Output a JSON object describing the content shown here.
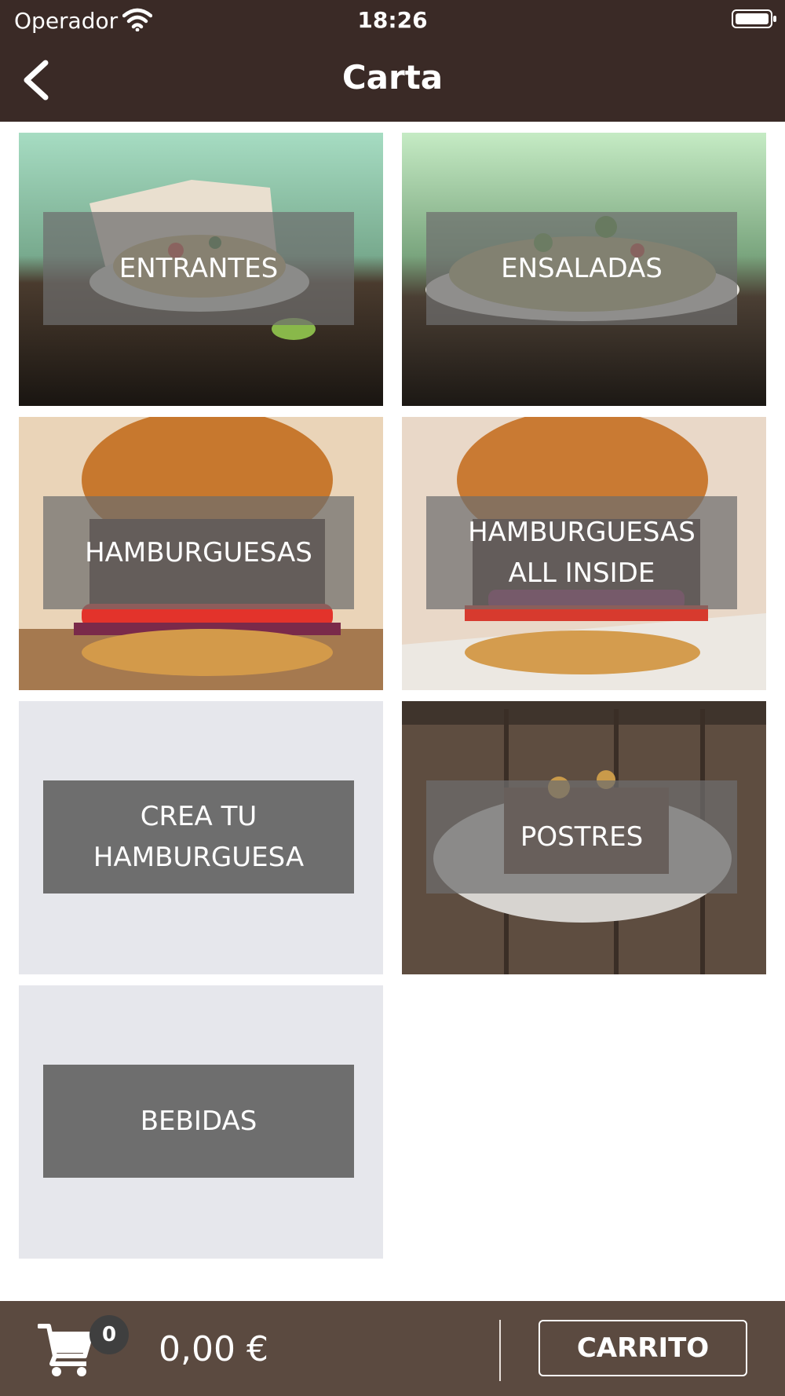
{
  "status_bar": {
    "carrier": "Operador",
    "time": "18:26"
  },
  "nav": {
    "title": "Carta"
  },
  "categories": [
    {
      "label": "ENTRANTES"
    },
    {
      "label": "ENSALADAS"
    },
    {
      "label": "HAMBURGUESAS"
    },
    {
      "label": "HAMBURGUESAS\nALL INSIDE"
    },
    {
      "label": "CREA TU\nHAMBURGUESA"
    },
    {
      "label": "POSTRES"
    },
    {
      "label": "BEBIDAS"
    }
  ],
  "cart": {
    "count": "0",
    "total": "0,00 €",
    "button_label": "CARRITO"
  },
  "colors": {
    "header_bg": "#3a2a26",
    "footer_bg": "#5b4a40",
    "label_bg": "#6e6e6e",
    "placeholder_bg": "#e6e7ec"
  }
}
